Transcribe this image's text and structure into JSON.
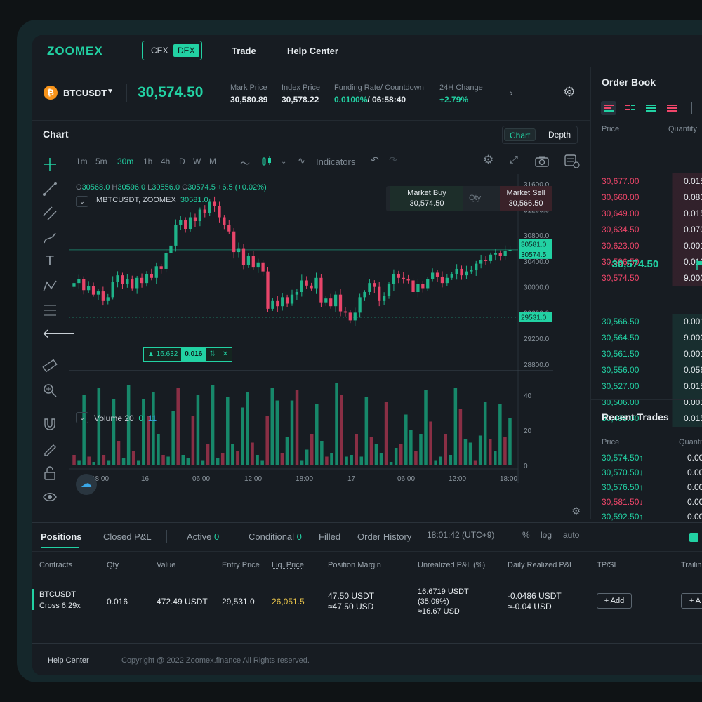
{
  "brand": {
    "logo": "ZOOMEX",
    "accent": "#22d1a3",
    "down": "#f0466a"
  },
  "mode_toggle": {
    "cex": "CEX",
    "dex": "DEX"
  },
  "nav": {
    "trade": "Trade",
    "help": "Help Center"
  },
  "ticker": {
    "symbol": "BTCUSDT",
    "coin_icon": "bitcoin-icon",
    "last_price": "30,574.50",
    "mark_price_label": "Mark Price",
    "mark_price": "30,580.89",
    "index_price_label": "Index Price",
    "index_price": "30,578.22",
    "funding_label": "Funding Rate/ Countdown",
    "funding_rate": "0.0100%",
    "countdown": "/ 06:58:40",
    "change_label": "24H Change",
    "change": "+2.79%"
  },
  "chart_panel": {
    "title": "Chart",
    "view_chart": "Chart",
    "view_depth": "Depth",
    "timeframes": [
      "1m",
      "5m",
      "30m",
      "1h",
      "4h",
      "D",
      "W",
      "M"
    ],
    "active_timeframe": "30m",
    "indicators": "Indicators",
    "ohlc": {
      "o_label": "O",
      "o": "30568.0",
      "h_label": "H",
      "h": "30596.0",
      "l_label": "L",
      "l": "30556.0",
      "c_label": "C",
      "c": "30574.5",
      "chg": "+6.5 (+0.02%)"
    },
    "series_label": ".MBTCUSDT, ZOOMEX",
    "series_value": "30581.0",
    "market_buy_label": "Market Buy",
    "market_buy": "30,574.50",
    "qty_label": "Qty",
    "market_sell_label": "Market Sell",
    "market_sell": "30,566.50",
    "position_tag": {
      "pnl": "▲ 16.632",
      "qty": "0.016",
      "arrows": "⇅",
      "close": "✕"
    },
    "volume_label": "Volume 20",
    "volume_v1": "0",
    "volume_v2": "11",
    "timestamp": "18:01:42 (UTC+9)",
    "axis_opts": [
      "%",
      "log",
      "auto"
    ]
  },
  "chart_data": {
    "type": "candlestick",
    "price_ticks": [
      "31600.0",
      "31200.0",
      "30800.0",
      "30400.0",
      "30000.0",
      "29600.0",
      "29200.0",
      "28800.0"
    ],
    "price_range": [
      28700,
      31750
    ],
    "price_labels": [
      {
        "value": 30581.0,
        "text": "30581.0",
        "color": "#22d1a3"
      },
      {
        "value": 30574.5,
        "text": "30574.5",
        "color": "#22d1a3"
      },
      {
        "value": 29531.0,
        "text": "29531.0",
        "color": "#22d1a3"
      }
    ],
    "volume_ticks": [
      "40",
      "20",
      "0"
    ],
    "time_ticks": [
      "18:00",
      "16",
      "06:00",
      "12:00",
      "18:00",
      "17",
      "06:00",
      "12:00",
      "18:00"
    ],
    "candle_closes": [
      30060,
      30120,
      29950,
      30010,
      29880,
      29930,
      29780,
      29840,
      30080,
      30180,
      30040,
      30120,
      29980,
      30140,
      30060,
      30200,
      30140,
      30320,
      30280,
      30520,
      30640,
      30960,
      31040,
      30900,
      31080,
      31020,
      31200,
      31140,
      31320,
      31260,
      31080,
      30960,
      30860,
      30540,
      30600,
      30340,
      30480,
      30300,
      30380,
      30240,
      29660,
      29780,
      29700,
      29840,
      29740,
      29880,
      29920,
      30100,
      30020,
      29980,
      30140,
      29760,
      29820,
      29700,
      29880,
      29620,
      29600,
      29480,
      29600,
      29840,
      29920,
      30060,
      30000,
      29780,
      29860,
      30040,
      30200,
      30140,
      30120,
      30100,
      29920,
      30040,
      29980,
      30120,
      30220,
      30160,
      30060,
      30140,
      30200,
      30280,
      30180,
      30240,
      30260,
      30360,
      30420,
      30400,
      30500,
      30520,
      30480,
      30560,
      30574
    ],
    "volumes": [
      6,
      3,
      40,
      5,
      2,
      44,
      6,
      3,
      38,
      14,
      4,
      46,
      8,
      3,
      38,
      28,
      42,
      18,
      6,
      5,
      31,
      44,
      6,
      4,
      28,
      40,
      3,
      12,
      46,
      4,
      7,
      39,
      12,
      8,
      33,
      42,
      13,
      6,
      3,
      28,
      44,
      37,
      7,
      16,
      37,
      43,
      3,
      9,
      18,
      35,
      14,
      5,
      7,
      47,
      40,
      5,
      6,
      18,
      5,
      39,
      16,
      12,
      7,
      36,
      2,
      10,
      12,
      29,
      20,
      8,
      18,
      43,
      25,
      3,
      5,
      18,
      6,
      44,
      32,
      15,
      13,
      3,
      17,
      36,
      15,
      8,
      35,
      16,
      27
    ],
    "up_color": "#1fb389",
    "down_color": "#e8456a"
  },
  "order_book": {
    "title": "Order Book",
    "col_price": "Price",
    "col_qty": "Quantity",
    "asks": [
      {
        "p": "30,677.00",
        "q": "0.015"
      },
      {
        "p": "30,660.00",
        "q": "0.083"
      },
      {
        "p": "30,649.00",
        "q": "0.015"
      },
      {
        "p": "30,634.50",
        "q": "0.070"
      },
      {
        "p": "30,623.00",
        "q": "0.001"
      },
      {
        "p": "30,596.50",
        "q": "0.010"
      },
      {
        "p": "30,574.50",
        "q": "9.000"
      }
    ],
    "mid": "↑30,574.50",
    "bids": [
      {
        "p": "30,566.50",
        "q": "0.001"
      },
      {
        "p": "30,564.50",
        "q": "9.000"
      },
      {
        "p": "30,561.50",
        "q": "0.001"
      },
      {
        "p": "30,556.00",
        "q": "0.056"
      },
      {
        "p": "30,527.00",
        "q": "0.015"
      },
      {
        "p": "30,506.00",
        "q": "0.001"
      },
      {
        "p": "30,499.00",
        "q": "0.015"
      }
    ]
  },
  "recent_trades": {
    "title": "Recent Trades",
    "col_price": "Price",
    "col_qty": "Quantity",
    "rows": [
      {
        "p": "30,574.50↑",
        "q": "0.00",
        "side": "up"
      },
      {
        "p": "30,570.50↓",
        "q": "0.00",
        "side": "up"
      },
      {
        "p": "30,576.50↑",
        "q": "0.00",
        "side": "up"
      },
      {
        "p": "30,581.50↓",
        "q": "0.00",
        "side": "down"
      },
      {
        "p": "30,592.50↑",
        "q": "0.00",
        "side": "up"
      }
    ]
  },
  "positions": {
    "tabs": {
      "positions": "Positions",
      "closed": "Closed P&L",
      "active": "Active",
      "active_n": "0",
      "conditional": "Conditional",
      "conditional_n": "0",
      "filled": "Filled",
      "history": "Order History"
    },
    "columns": {
      "contracts": "Contracts",
      "qty": "Qty",
      "value": "Value",
      "entry": "Entry Price",
      "liq": "Liq. Price",
      "margin": "Position Margin",
      "upnl": "Unrealized P&L (%)",
      "drpnl": "Daily Realized P&L",
      "tpsl": "TP/SL",
      "trailing": "Trailing"
    },
    "row": {
      "contract": "BTCUSDT",
      "leverage": "Cross 6.29x",
      "qty": "0.016",
      "value": "472.49  USDT",
      "entry": "29,531.0",
      "liq": "26,051.5",
      "margin1": "47.50 USDT",
      "margin2": "≈47.50 USD",
      "upnl1": "16.6719 USDT",
      "upnl2": "(35.09%)",
      "upnl3": "≈16.67 USD",
      "drpnl1": "-0.0486 USDT",
      "drpnl2": "≈-0.04 USD",
      "add": "+ Add",
      "add2": "+ A"
    }
  },
  "footer": {
    "help": "Help Center",
    "copyright": "Copyright @ 2022 Zoomex.finance All Rights reserved."
  }
}
